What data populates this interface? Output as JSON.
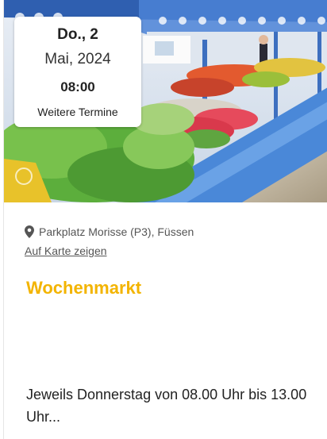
{
  "event": {
    "date": {
      "day": "Do., 2",
      "month_year": "Mai, 2024",
      "time": "08:00",
      "more_dates": "Weitere Termine"
    },
    "location": {
      "icon": "map-pin-icon",
      "text": "Parkplatz Morisse (P3), Füssen",
      "map_link": "Auf Karte zeigen"
    },
    "title": "Wochenmarkt",
    "description": "Jeweils Donnerstag von 08.00 Uhr bis 13.00 Uhr...",
    "colors": {
      "title": "#f3b400",
      "awning": "#3a73c8"
    }
  }
}
